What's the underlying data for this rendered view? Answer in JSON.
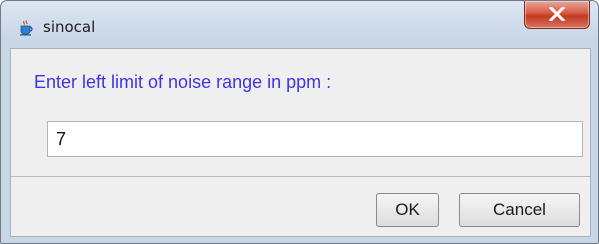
{
  "window": {
    "title": "sinocal",
    "icon": "java-cup-icon",
    "close_glyph": "x"
  },
  "dialog": {
    "prompt": "Enter left limit of noise range in ppm :",
    "input_value": "7",
    "ok_label": "OK",
    "cancel_label": "Cancel"
  },
  "colors": {
    "prompt_text": "#3e34e6",
    "close_button": "#d24b33",
    "content_bg": "#efefef"
  }
}
